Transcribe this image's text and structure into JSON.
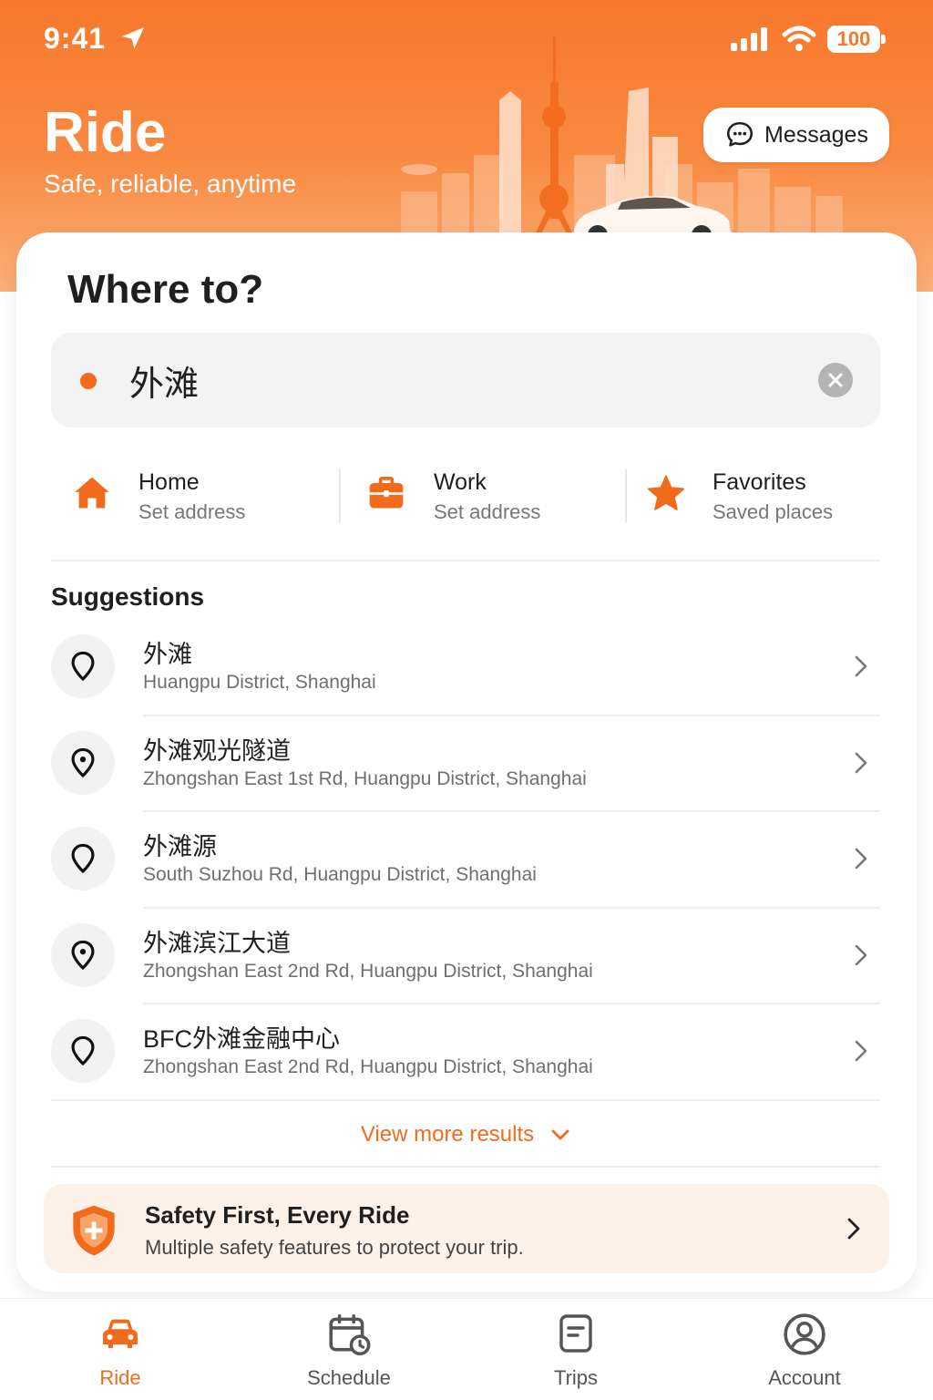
{
  "status_bar": {
    "time": "9:41",
    "battery": "100"
  },
  "header": {
    "title": "Ride",
    "subtitle": "Safe, reliable, anytime",
    "messages_label": "Messages"
  },
  "search": {
    "heading": "Where to?",
    "value": "外滩",
    "placeholder": ""
  },
  "shortcuts": [
    {
      "label": "Home",
      "sub": "Set address",
      "icon": "home-icon"
    },
    {
      "label": "Work",
      "sub": "Set address",
      "icon": "briefcase-icon"
    },
    {
      "label": "Favorites",
      "sub": "Saved places",
      "icon": "star-icon"
    }
  ],
  "suggestions": {
    "title": "Suggestions",
    "items": [
      {
        "name": "外滩",
        "address": "Huangpu District, Shanghai"
      },
      {
        "name": "外滩观光隧道",
        "address": "Zhongshan East 1st Rd, Huangpu District, Shanghai"
      },
      {
        "name": "外滩源",
        "address": "South Suzhou Rd, Huangpu District, Shanghai"
      },
      {
        "name": "外滩滨江大道",
        "address": "Zhongshan East 2nd Rd, Huangpu District, Shanghai"
      },
      {
        "name": "BFC外滩金融中心",
        "address": "Zhongshan East 2nd Rd, Huangpu District, Shanghai"
      }
    ],
    "view_more": "View more results"
  },
  "safety": {
    "title": "Safety First, Every Ride",
    "subtitle": "Multiple safety features to protect your trip."
  },
  "tabs": [
    {
      "label": "Ride",
      "icon": "car-icon",
      "active": true
    },
    {
      "label": "Schedule",
      "icon": "calendar-clock-icon",
      "active": false
    },
    {
      "label": "Trips",
      "icon": "document-icon",
      "active": false
    },
    {
      "label": "Account",
      "icon": "user-icon",
      "active": false
    }
  ],
  "colors": {
    "accent": "#f26b1d",
    "header_gradient_top": "#f7782c",
    "safety_bg": "#fef1e8"
  }
}
